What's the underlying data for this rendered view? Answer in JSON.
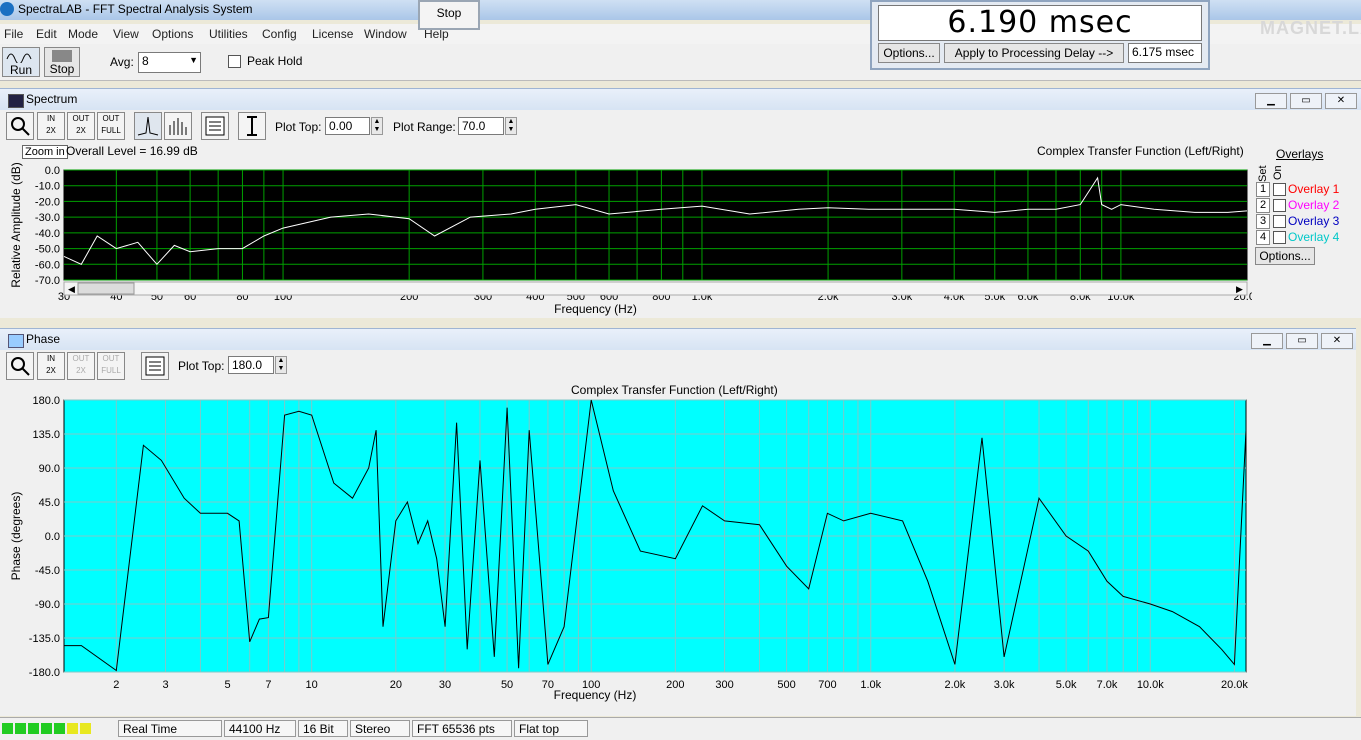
{
  "window": {
    "title": "SpectraLAB - FFT Spectral Analysis System",
    "stop_popup": "Stop"
  },
  "menu": [
    "File",
    "Edit",
    "Mode",
    "View",
    "Options",
    "Utilities",
    "Config",
    "License",
    "Window",
    "Help"
  ],
  "toolbar": {
    "run_label": "Run",
    "stop_label": "Stop",
    "avg_label": "Avg:",
    "avg_value": "8",
    "peak_hold_label": "Peak Hold"
  },
  "delay": {
    "value": "6.190 msec",
    "options_label": "Options...",
    "apply_label": "Apply to Processing Delay -->",
    "processing_delay": "6.175 msec"
  },
  "watermark": "MAGNET.LA",
  "spectrum": {
    "panel_title": "Spectrum",
    "plot_top_label": "Plot Top:",
    "plot_top_value": "0.00",
    "plot_range_label": "Plot Range:",
    "plot_range_value": "70.0",
    "tooltip": "Zoom in",
    "overall_level": "Overall Level = 16.99 dB",
    "chart_title": "Complex Transfer Function (Left/Right)",
    "ylabel": "Relative Amplitude (dB)",
    "xlabel": "Frequency (Hz)",
    "overlays_title": "Overlays",
    "set_label": "Set",
    "on_label": "On",
    "overlays": [
      {
        "num": "1",
        "label": "Overlay 1",
        "color": "#ff0000"
      },
      {
        "num": "2",
        "label": "Overlay 2",
        "color": "#ff00ff"
      },
      {
        "num": "3",
        "label": "Overlay 3",
        "color": "#0000c0"
      },
      {
        "num": "4",
        "label": "Overlay 4",
        "color": "#00c8c8"
      }
    ],
    "options_label": "Options..."
  },
  "phase": {
    "panel_title": "Phase",
    "plot_top_label": "Plot Top:",
    "plot_top_value": "180.0",
    "chart_title": "Complex Transfer Function (Left/Right)",
    "ylabel": "Phase (degrees)",
    "xlabel": "Frequency (Hz)"
  },
  "status": [
    "Real Time",
    "44100 Hz",
    "16 Bit",
    "Stereo",
    "FFT 65536 pts",
    "Flat top"
  ],
  "chart_data": [
    {
      "type": "line",
      "title": "Complex Transfer Function (Left/Right)",
      "xlabel": "Frequency (Hz)",
      "ylabel": "Relative Amplitude (dB)",
      "x_scale": "log",
      "xlim": [
        30,
        20000
      ],
      "ylim": [
        -70,
        0
      ],
      "grid": true,
      "background": "#000000",
      "grid_color": "#00a000",
      "line_color": "#ffffff",
      "yticks": [
        "0.0",
        "-10.0",
        "-20.0",
        "-30.0",
        "-40.0",
        "-50.0",
        "-60.0",
        "-70.0"
      ],
      "xticks": [
        "30",
        "40",
        "50",
        "60",
        "80",
        "100",
        "200",
        "300",
        "400",
        "500",
        "600",
        "800",
        "1.0k",
        "2.0k",
        "3.0k",
        "4.0k",
        "5.0k",
        "6.0k",
        "8.0k",
        "10.0k",
        "20.0k"
      ],
      "series": [
        {
          "x": [
            30,
            33,
            36,
            40,
            45,
            50,
            55,
            60,
            70,
            80,
            90,
            100,
            130,
            160,
            200,
            230,
            280,
            350,
            400,
            500,
            600,
            800,
            1000,
            1300,
            1700,
            2000,
            2500,
            3000,
            4000,
            5000,
            6000,
            7000,
            8000,
            8800,
            9000,
            9500,
            10000,
            12000,
            15000,
            18000,
            20000
          ],
          "y": [
            -55,
            -60,
            -42,
            -50,
            -46,
            -60,
            -48,
            -52,
            -50,
            -50,
            -42,
            -37,
            -30,
            -28,
            -31,
            -42,
            -30,
            -28,
            -25,
            -22,
            -28,
            -25,
            -23,
            -28,
            -25,
            -24,
            -25,
            -25,
            -25,
            -27,
            -25,
            -25,
            -22,
            -5,
            -22,
            -25,
            -22,
            -25,
            -27,
            -27,
            -26
          ]
        }
      ]
    },
    {
      "type": "line",
      "title": "Complex Transfer Function (Left/Right)",
      "xlabel": "Frequency (Hz)",
      "ylabel": "Phase (degrees)",
      "x_scale": "log",
      "xlim": [
        1.3,
        22000
      ],
      "ylim": [
        -180,
        180
      ],
      "grid": true,
      "background": "#00ffff",
      "grid_color": "#7fc8c8",
      "line_color": "#000000",
      "yticks": [
        "180.0",
        "135.0",
        "90.0",
        "45.0",
        "0.0",
        "-45.0",
        "-90.0",
        "-135.0",
        "-180.0"
      ],
      "xticks": [
        "2",
        "3",
        "5",
        "7",
        "10",
        "20",
        "30",
        "50",
        "70",
        "100",
        "200",
        "300",
        "500",
        "700",
        "1.0k",
        "2.0k",
        "3.0k",
        "5.0k",
        "7.0k",
        "10.0k",
        "20.0k"
      ],
      "series": [
        {
          "x": [
            1.3,
            1.5,
            2,
            2.5,
            2.9,
            3.5,
            4,
            5,
            5.5,
            6,
            6.5,
            7,
            8,
            9,
            10,
            12,
            14,
            16,
            17,
            18,
            20,
            22,
            24,
            26,
            28,
            30,
            33,
            36,
            40,
            45,
            50,
            55,
            60,
            70,
            80,
            100,
            120,
            150,
            200,
            250,
            300,
            400,
            500,
            600,
            700,
            800,
            1000,
            1300,
            1600,
            2000,
            2500,
            3000,
            4000,
            5000,
            6000,
            7000,
            8000,
            10000,
            12000,
            15000,
            18000,
            20000,
            22000
          ],
          "y": [
            -145,
            -145,
            -178,
            120,
            100,
            50,
            30,
            30,
            20,
            -140,
            -110,
            -108,
            160,
            165,
            160,
            70,
            50,
            90,
            140,
            -120,
            20,
            45,
            -10,
            20,
            -30,
            -120,
            150,
            -150,
            100,
            -160,
            170,
            -175,
            140,
            -170,
            -120,
            180,
            60,
            -20,
            -30,
            40,
            20,
            15,
            -40,
            -70,
            30,
            20,
            30,
            20,
            -60,
            -170,
            130,
            -160,
            50,
            0,
            -20,
            -60,
            -80,
            -90,
            -100,
            -120,
            -150,
            -170,
            140
          ]
        }
      ]
    }
  ]
}
